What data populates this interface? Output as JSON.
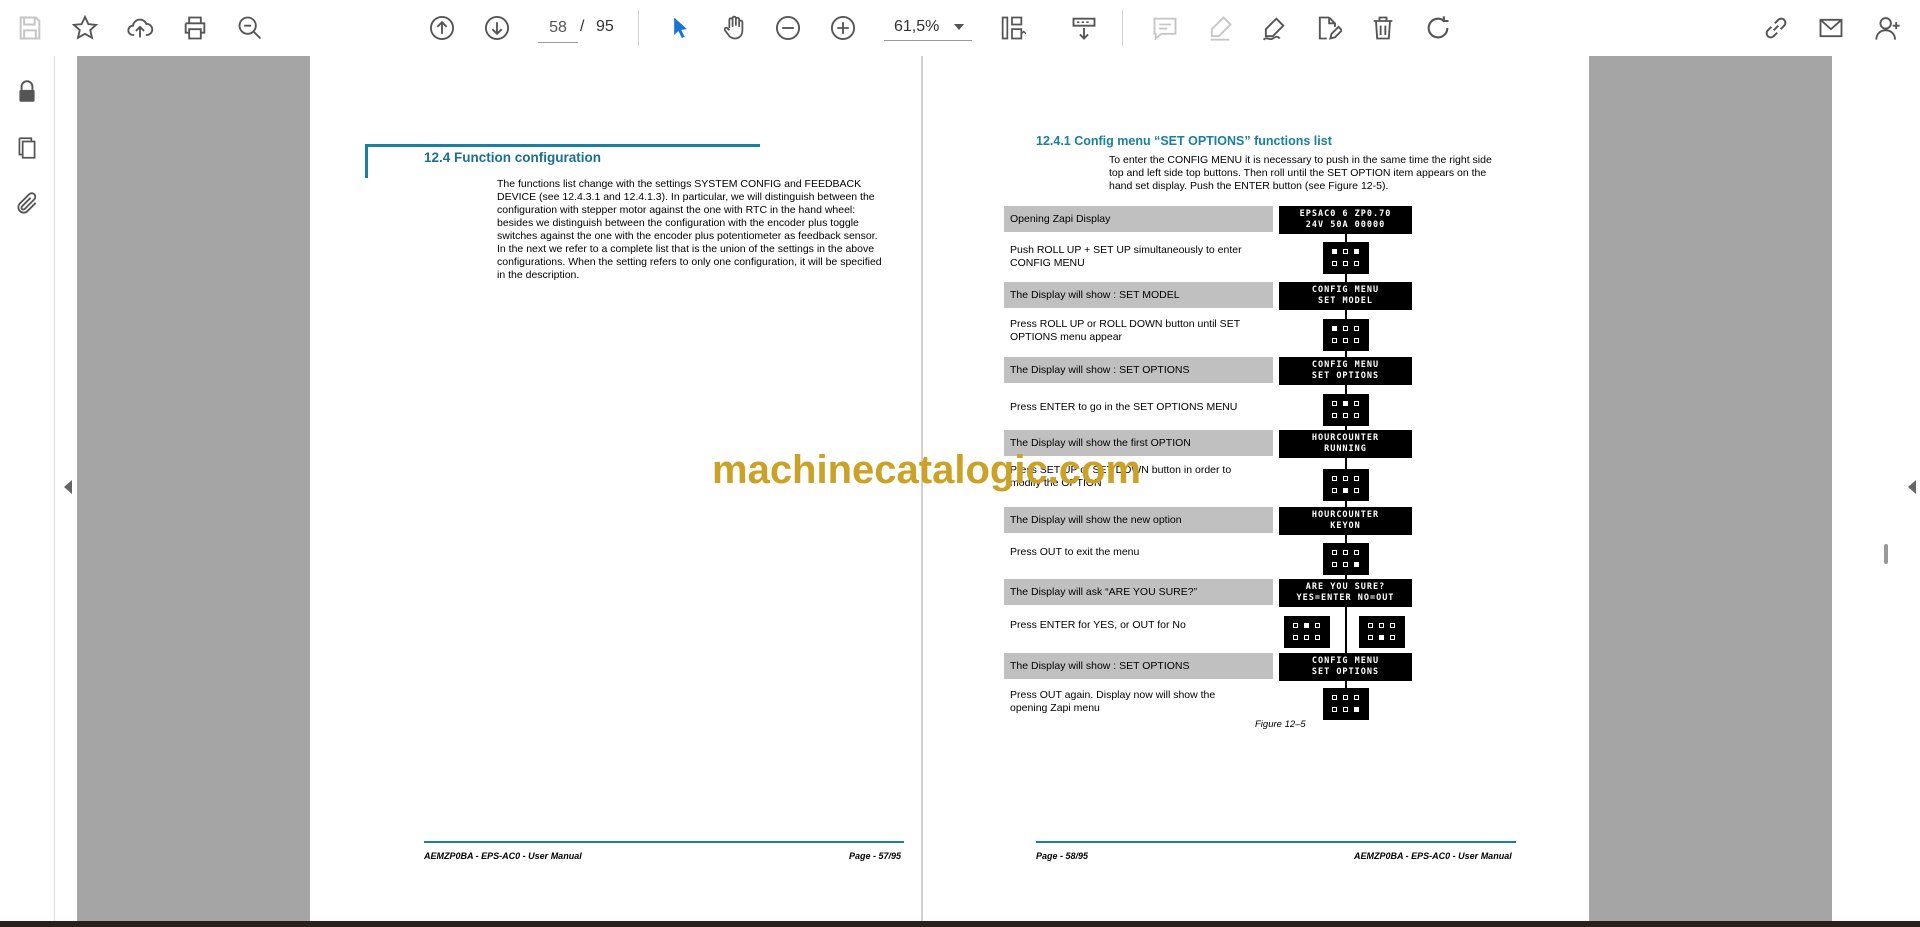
{
  "toolbar": {
    "page_current": "58",
    "page_separator": "/",
    "page_total": "95",
    "zoom": "61,5%",
    "icons": [
      "save-icon",
      "bookmark-star-icon",
      "cloud-upload-icon",
      "print-icon",
      "zoom-search-icon",
      "page-up-icon",
      "page-down-icon",
      "select-cursor-icon",
      "hand-tool-icon",
      "zoom-out-icon",
      "zoom-in-icon",
      "page-layout-icon",
      "scroll-mode-icon",
      "comment-icon",
      "highlight-icon",
      "sign-icon",
      "edit-pdf-icon",
      "delete-icon",
      "rotate-icon",
      "share-link-icon",
      "email-icon",
      "add-user-icon"
    ]
  },
  "leftrail": {
    "icons": [
      "lock-icon",
      "copy-pages-icon",
      "attachment-icon"
    ]
  },
  "left_page": {
    "section_title": "12.4 Function configuration",
    "paragraph_lines": [
      "The functions list change with the settings SYSTEM CONFIG and FEEDBACK",
      "DEVICE (see 12.4.3.1 and 12.4.1.3). In particular, we will distinguish between the",
      "configuration with stepper motor against the one with RTC in the hand wheel:",
      "besides we distinguish between the configuration with the encoder plus toggle",
      "switches against the one with the encoder plus potentiometer as feedback sensor.",
      "In the next we refer to a complete list that is the union of the settings in the above",
      "configurations. When the setting refers to only one configuration, it will be specified",
      "in the description."
    ],
    "footer_left": "AEMZP0BA - EPS-AC0 - User Manual",
    "footer_right": "Page - 57/95"
  },
  "right_page": {
    "subsection_title": "12.4.1 Config menu “SET OPTIONS” functions list",
    "intro_lines": [
      "To enter the CONFIG MENU it is necessary to push in the same time the right side",
      "top and left side top buttons. Then roll until the SET OPTION item appears on the",
      "hand set display. Push the ENTER button (see Figure 12-5)."
    ],
    "steps": [
      {
        "lines": [
          "Opening Zapi Display"
        ],
        "gray": true
      },
      {
        "lines": [
          "Push ROLL UP + SET UP simultaneously to enter",
          "CONFIG MENU"
        ],
        "gray": false
      },
      {
        "lines": [
          "The Display will show : SET MODEL"
        ],
        "gray": true
      },
      {
        "lines": [
          "Press ROLL UP or ROLL DOWN button until SET",
          "OPTIONS menu appear"
        ],
        "gray": false
      },
      {
        "lines": [
          "The Display will show : SET OPTIONS"
        ],
        "gray": true
      },
      {
        "lines": [
          "Press ENTER to go in the SET OPTIONS MENU"
        ],
        "gray": false
      },
      {
        "lines": [
          "The Display will show the first OPTION"
        ],
        "gray": true
      },
      {
        "lines": [
          "Press SET UP or SET DOWN button in order to",
          "modify the OPTION"
        ],
        "gray": false
      },
      {
        "lines": [
          "The Display will show the new option"
        ],
        "gray": true
      },
      {
        "lines": [
          "Press OUT to exit the menu"
        ],
        "gray": false
      },
      {
        "lines": [
          "The Display will ask “ARE YOU SURE?”"
        ],
        "gray": true
      },
      {
        "lines": [
          "Press  ENTER for YES, or  OUT for No"
        ],
        "gray": false
      },
      {
        "lines": [
          "The Display will show : SET OPTIONS"
        ],
        "gray": true
      },
      {
        "lines": [
          "Press OUT again. Display now will show the",
          "opening Zapi menu"
        ],
        "gray": false
      }
    ],
    "lcds": [
      {
        "line1": "EPSAC0   6  ZP0.70",
        "line2": "24V  50A   00000"
      },
      {
        "line1": "CONFIG MENU",
        "line2": "SET MODEL"
      },
      {
        "line1": "CONFIG MENU",
        "line2": "SET OPTIONS"
      },
      {
        "line1": "HOURCOUNTER",
        "line2": "RUNNING"
      },
      {
        "line1": "HOURCOUNTER",
        "line2": "KEYON"
      },
      {
        "line1": "ARE YOU SURE?",
        "line2": "YES=ENTER NO=OUT"
      },
      {
        "line1": "CONFIG MENU",
        "line2": "SET OPTIONS"
      }
    ],
    "figure_caption": "Figure 12–5",
    "footer_left": "Page - 58/95",
    "footer_right": "AEMZP0BA - EPS-AC0 - User Manual"
  },
  "watermark": "machinecatalogic.com"
}
